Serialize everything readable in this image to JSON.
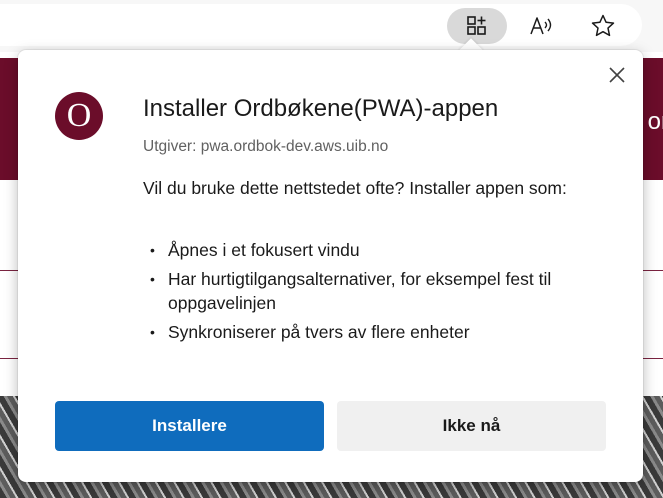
{
  "toolbar": {
    "app_available_icon": "app-available-icon",
    "read_aloud_icon": "read-aloud-icon",
    "favorite_icon": "star-icon"
  },
  "page": {
    "header_partial_text": "or",
    "header_color": "#6b0d2a"
  },
  "dialog": {
    "logo_letter": "O",
    "title": "Installer Ordbøkene(PWA)-appen",
    "publisher": "Utgiver: pwa.ordbok-dev.aws.uib.no",
    "description": "Vil du bruke dette nettstedet ofte? Installer appen som:",
    "features": [
      "Åpnes i et fokusert vindu",
      "Har hurtigtilgangsalternativer, for eksempel fest til oppgavelinjen",
      "Synkroniserer på tvers av flere enheter"
    ],
    "install_label": "Installere",
    "not_now_label": "Ikke nå",
    "accent_color": "#0f6cbd"
  }
}
